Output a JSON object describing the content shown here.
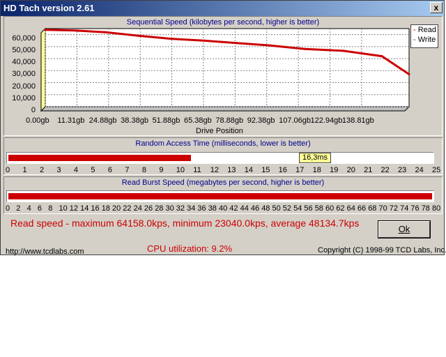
{
  "window": {
    "title": "HD Tach version 2.61",
    "close_label": "x"
  },
  "sequential": {
    "title": "Sequential Speed (kilobytes per second, higher is better)",
    "y_ticks": [
      "0",
      "10,000",
      "20,000",
      "30,000",
      "40,000",
      "50,000",
      "60,000"
    ],
    "x_ticks": [
      "0.00gb",
      "11.31gb",
      "24.88gb",
      "38.38gb",
      "51.88gb",
      "65.38gb",
      "78.88gb",
      "92.38gb",
      "107.06gb",
      "122.94gb",
      "138.81gb"
    ],
    "x_label": "Drive Position",
    "legend": {
      "read": "Read",
      "write": "Write"
    }
  },
  "chart_data": {
    "type": "line",
    "title": "Sequential Speed (kilobytes per second, higher is better)",
    "xlabel": "Drive Position",
    "ylabel": "",
    "ylim": [
      0,
      65000
    ],
    "x": [
      0,
      11.31,
      24.88,
      38.38,
      51.88,
      65.38,
      78.88,
      92.38,
      107.06,
      122.94,
      138.81,
      150
    ],
    "series": [
      {
        "name": "Read",
        "values": [
          64000,
          63500,
          62000,
          59000,
          56500,
          55000,
          53000,
          51000,
          48000,
          46500,
          42000,
          27000
        ]
      }
    ]
  },
  "random_access": {
    "title": "Random Access Time (milliseconds, lower is better)",
    "value_label": "16,3ms",
    "value": 16.3,
    "max": 25,
    "ticks": [
      "0",
      "1",
      "2",
      "3",
      "4",
      "5",
      "6",
      "7",
      "8",
      "9",
      "10",
      "11",
      "12",
      "13",
      "14",
      "15",
      "16",
      "17",
      "18",
      "19",
      "20",
      "21",
      "22",
      "23",
      "24",
      "25"
    ]
  },
  "burst": {
    "title": "Read Burst Speed (megabytes per second, higher is better)",
    "value": 80,
    "max": 80,
    "ticks": [
      "0",
      "2",
      "4",
      "6",
      "8",
      "10",
      "12",
      "14",
      "16",
      "18",
      "20",
      "22",
      "24",
      "26",
      "28",
      "30",
      "32",
      "34",
      "36",
      "38",
      "40",
      "42",
      "44",
      "46",
      "48",
      "50",
      "52",
      "54",
      "56",
      "58",
      "60",
      "62",
      "64",
      "66",
      "68",
      "70",
      "72",
      "74",
      "76",
      "78",
      "80"
    ]
  },
  "summary": {
    "read_speed": "Read speed - maximum 64158.0kps, minimum 23040.0kps, average 48134.7kps",
    "cpu": "CPU utilization: 9.2%"
  },
  "ok_button": "Ok",
  "footer": {
    "url": "http://www.tcdlabs.com",
    "copyright": "Copyright (C) 1998-99 TCD Labs, Inc."
  },
  "colors": {
    "read": "#cc0000",
    "title_blue": "#00008b"
  }
}
